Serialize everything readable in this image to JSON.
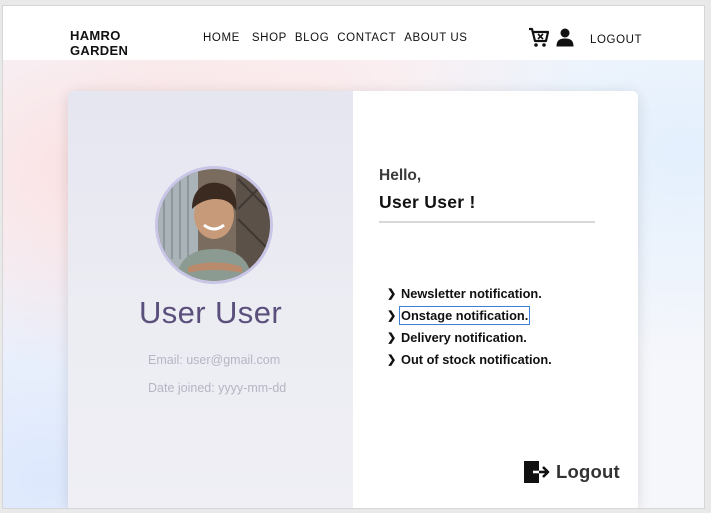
{
  "brand": {
    "line1": "HAMRO",
    "line2": "GARDEN"
  },
  "nav": {
    "links": [
      "HOME",
      "SHOP",
      "BLOG",
      "CONTACT",
      "ABOUT US"
    ],
    "logout": "LOGOUT",
    "icons": {
      "cart": "cart-icon",
      "user": "user-icon"
    }
  },
  "profile": {
    "name": "User User",
    "email": "Email: user@gmail.com",
    "joined": "Date joined: yyyy-mm-dd"
  },
  "greeting": {
    "hello": "Hello,",
    "user": "User User !"
  },
  "notifications": [
    "Newsletter notification.",
    "Onstage notification.",
    "Delivery notification.",
    "Out of stock notification."
  ],
  "logout_button": {
    "label": "Logout",
    "icon": "logout-icon"
  },
  "colors": {
    "name_text": "#5b4f7c",
    "focus_outline": "#3b82d6",
    "left_panel": "#e6e6f1"
  }
}
